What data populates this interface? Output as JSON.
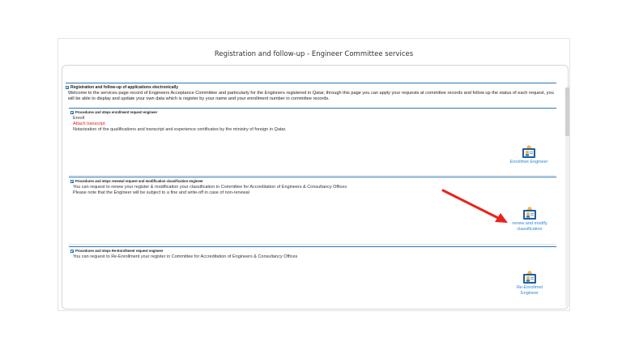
{
  "header": {
    "title": "Registration and follow-up - Engineer Committee services"
  },
  "intro": {
    "title": "Registration and follow-up of applications electronically",
    "text": "Welcome to the services page record of Engineers Acceptance Committee and particularly for the Enginners registered in Qatar, through this page you can apply your requests at committee records and follow up the status of each request, you will be able to display and update your own data which is register by your name and your enrollment number in committee records."
  },
  "sections": [
    {
      "title": "Procedures and steps enrollment request engineer",
      "lines": [
        "Enroll",
        "Attach transcript",
        "Notarization of the qualifications and transcript and experience certificates by the ministry of foreign in Qatar."
      ],
      "action_label": "Enrollmet Engineer"
    },
    {
      "title": "Procedures and steps renewal request and modification classification engineer",
      "lines": [
        "You can request to renew your register & modification your classification in Committee for Accreditation of Engineers & Consultancy Offices",
        "Please note that the Engineer will be subject to a fine and write-off in case of non-renewal"
      ],
      "action_label_1": "renew and modify",
      "action_label_2": "classification"
    },
    {
      "title": "Procedures and steps Re-Enrollment request engineer",
      "lines": [
        "You can request to Re-Enrollment your register in Committee for Accreditation of Engineers & Consultancy Offices"
      ],
      "action_label_1": "Re-Enrollmet",
      "action_label_2": "Engineer"
    }
  ],
  "colors": {
    "accent": "#2a78b4",
    "link": "#2f86d6",
    "highlight_red": "#e0201c",
    "arrow": "#e8231c"
  },
  "icons": {
    "engineer": "engineer-icon",
    "collapse": "collapse-icon",
    "arrow": "arrow-annotation"
  }
}
